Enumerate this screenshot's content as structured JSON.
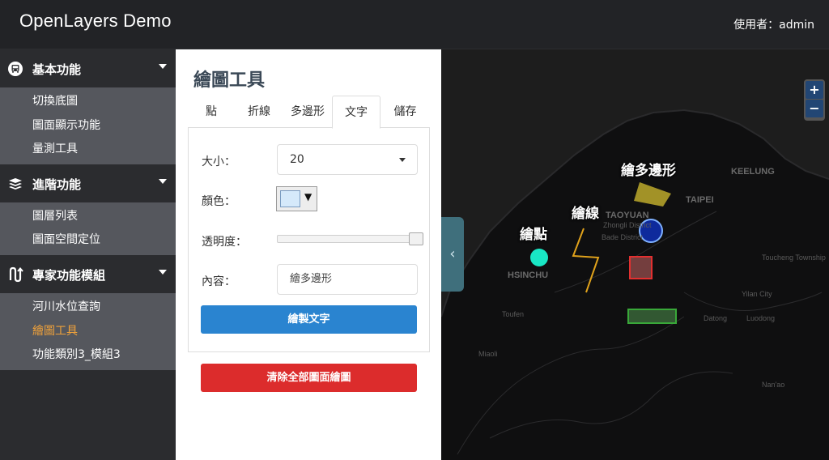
{
  "header": {
    "title": "OpenLayers Demo",
    "user": "使用者：admin"
  },
  "sidebar": {
    "groups": [
      {
        "label": "基本功能",
        "icon": "bus-icon",
        "items": [
          "切換底圖",
          "圖面顯示功能",
          "量測工具"
        ]
      },
      {
        "label": "進階功能",
        "icon": "layers-icon",
        "items": [
          "圖層列表",
          "圖面空間定位"
        ]
      },
      {
        "label": "專家功能模組",
        "icon": "route-icon",
        "items": [
          "河川水位查詢",
          "繪圖工具",
          "功能類別3_模組3"
        ]
      }
    ],
    "active_item": "繪圖工具",
    "active_color": "#f0a23a"
  },
  "panel": {
    "title": "繪圖工具",
    "tabs": [
      "點",
      "折線",
      "多邊形",
      "文字",
      "儲存"
    ],
    "active_tab": "文字",
    "form": {
      "size_label": "大小：",
      "size_value": "20",
      "color_label": "顏色：",
      "color_value": "#d5e9fa",
      "opacity_label": "透明度：",
      "opacity_value": 1.0,
      "content_label": "內容：",
      "content_value": "繪多邊形",
      "draw_button": "繪製文字"
    },
    "clear_button": "清除全部圖面繪圖"
  },
  "map": {
    "zoom_in": "+",
    "zoom_out": "−",
    "collapse": "‹",
    "drawn_labels": [
      "繪點",
      "繪線",
      "繪多邊形"
    ],
    "cities": [
      "KEELUNG",
      "TAIPEI",
      "TAOYUAN",
      "HSINCHU"
    ],
    "towns": [
      "Zhongli District",
      "Bade District",
      "Toucheng Township",
      "Yilan City",
      "Datong",
      "Luodong",
      "Toufen",
      "Miaoli",
      "Nan'ao"
    ]
  }
}
